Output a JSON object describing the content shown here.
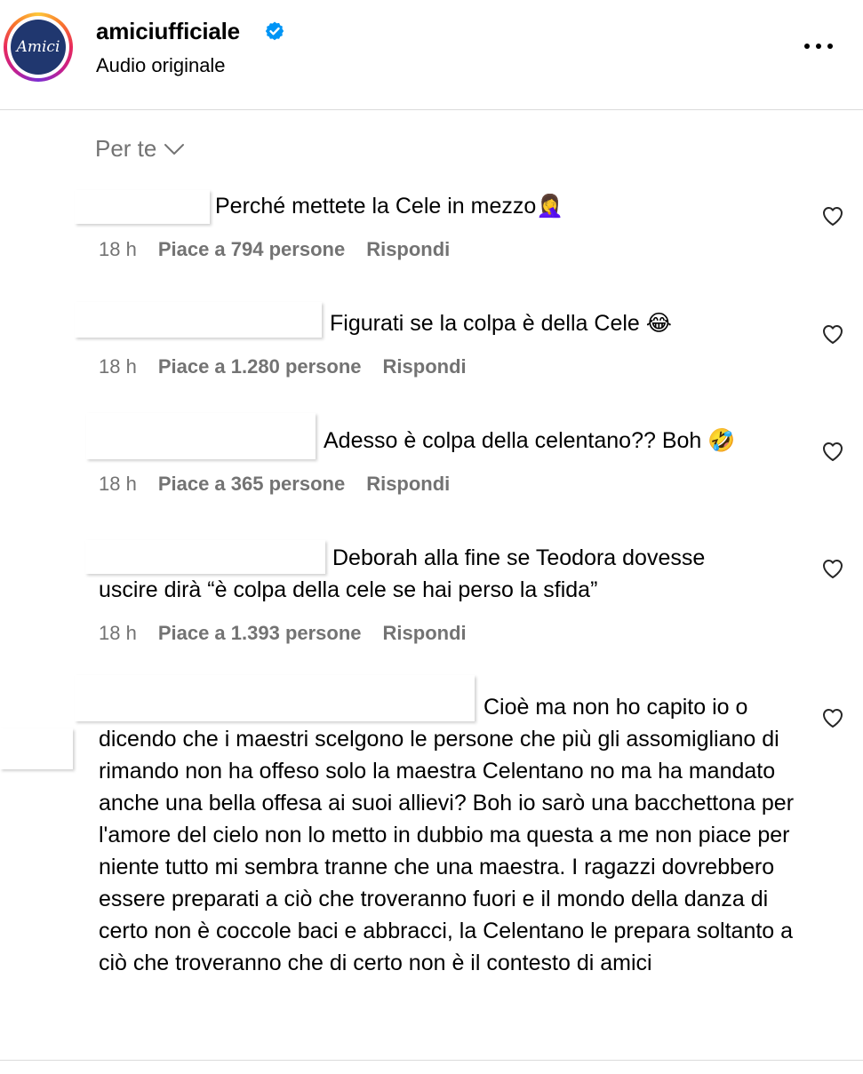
{
  "header": {
    "username": "amiciufficiale",
    "subtitle": "Audio originale",
    "avatar_text": "Amici",
    "verified_icon": "verified-badge-icon",
    "more_icon": "more-options-icon"
  },
  "sort": {
    "label": "Per te",
    "icon": "chevron-down-icon"
  },
  "comments": [
    {
      "text": "Perché mettete la Cele in mezzo🤦‍♀️",
      "time": "18 h",
      "likes": "Piace a 794 persone",
      "reply": "Rispondi"
    },
    {
      "text": "Figurati se la colpa è della Cele 😂",
      "time": "18 h",
      "likes": "Piace a 1.280 persone",
      "reply": "Rispondi"
    },
    {
      "text": "Adesso è colpa della celentano?? Boh 🤣",
      "time": "18 h",
      "likes": "Piace a 365 persone",
      "reply": "Rispondi"
    },
    {
      "text_line1": "Deborah alla fine se Teodora dovesse",
      "text_line2": "uscire dirà “è colpa della cele se hai perso la sfida”",
      "time": "18 h",
      "likes": "Piace a 1.393 persone",
      "reply": "Rispondi"
    },
    {
      "text_line1": "Cioè ma non ho capito io o",
      "text_rest": "dicendo che i maestri scelgono le persone che più gli assomigliano di rimando non ha offeso solo la maestra Celentano no ma ha mandato anche una bella offesa ai suoi allievi? Boh io sarò una bacchettona per l'amore del cielo non lo metto in dubbio ma questa a me non piace per niente tutto mi sembra tranne che una maestra. I ragazzi dovrebbero essere preparati a ciò che troveranno fuori e il mondo della danza di certo non è coccole baci e abbracci, la Celentano le prepara soltanto a ciò che troveranno che di certo non è il contesto di amici"
    }
  ],
  "colors": {
    "secondary_text": "#737373",
    "verified_blue": "#0095f6",
    "divider": "#dbdbdb"
  }
}
